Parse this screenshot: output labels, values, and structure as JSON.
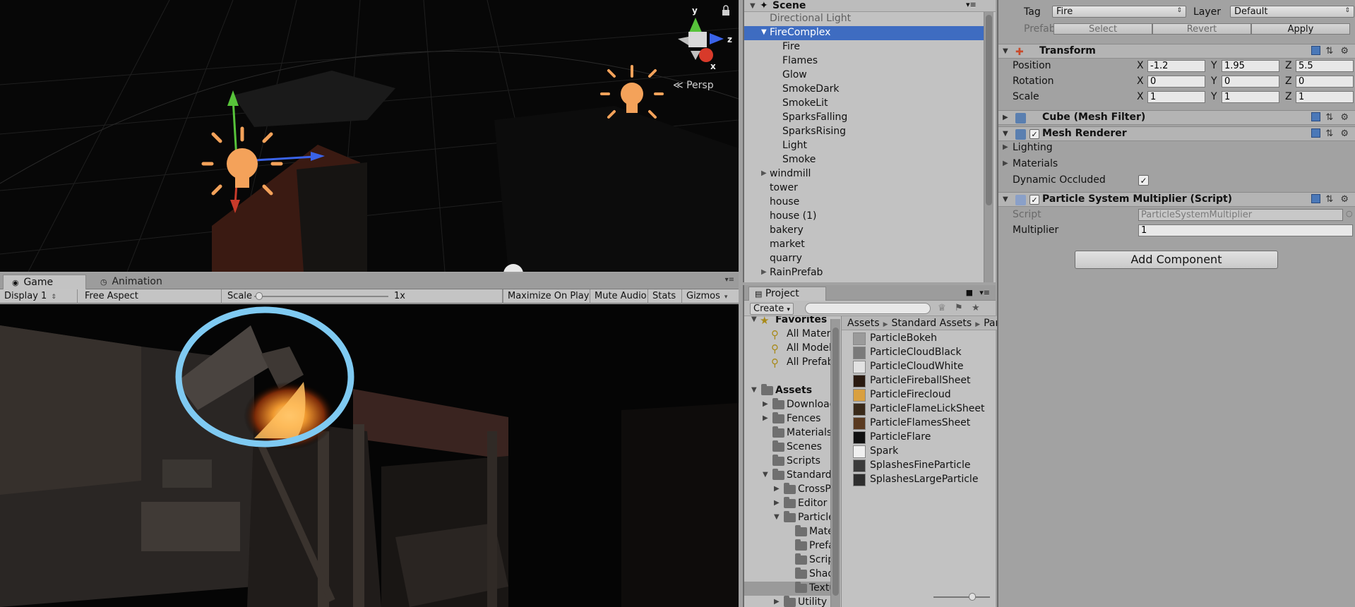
{
  "scene": {
    "tab_title": "Scene",
    "persp_label": "Persp",
    "gizmo_axes": {
      "y": "y",
      "z": "z",
      "x": "x"
    }
  },
  "game": {
    "tabs": [
      {
        "label": "Game",
        "icon": "game-controller-icon"
      },
      {
        "label": "Animation",
        "icon": "clock-icon"
      }
    ],
    "toolbar": {
      "display": "Display 1",
      "aspect": "Free Aspect",
      "scale_label": "Scale",
      "scale_value": "1x",
      "maximize": "Maximize On Play",
      "mute": "Mute Audio",
      "stats": "Stats",
      "gizmos": "Gizmos"
    }
  },
  "hierarchy": {
    "title": "Scene",
    "items": [
      {
        "label": "Directional Light",
        "indent": 0,
        "fold": "",
        "dim": true,
        "selected": false
      },
      {
        "label": "FireComplex",
        "indent": 0,
        "fold": "▼",
        "dim": false,
        "selected": true
      },
      {
        "label": "Fire",
        "indent": 1,
        "fold": "",
        "dim": false,
        "selected": false
      },
      {
        "label": "Flames",
        "indent": 1,
        "fold": "",
        "dim": false,
        "selected": false
      },
      {
        "label": "Glow",
        "indent": 1,
        "fold": "",
        "dim": false,
        "selected": false
      },
      {
        "label": "SmokeDark",
        "indent": 1,
        "fold": "",
        "dim": false,
        "selected": false
      },
      {
        "label": "SmokeLit",
        "indent": 1,
        "fold": "",
        "dim": false,
        "selected": false
      },
      {
        "label": "SparksFalling",
        "indent": 1,
        "fold": "",
        "dim": false,
        "selected": false
      },
      {
        "label": "SparksRising",
        "indent": 1,
        "fold": "",
        "dim": false,
        "selected": false
      },
      {
        "label": "Light",
        "indent": 1,
        "fold": "",
        "dim": false,
        "selected": false
      },
      {
        "label": "Smoke",
        "indent": 1,
        "fold": "",
        "dim": false,
        "selected": false
      },
      {
        "label": "windmill",
        "indent": 0,
        "fold": "▶",
        "dim": false,
        "selected": false
      },
      {
        "label": "tower",
        "indent": 0,
        "fold": "",
        "dim": false,
        "selected": false
      },
      {
        "label": "house",
        "indent": 0,
        "fold": "",
        "dim": false,
        "selected": false
      },
      {
        "label": "house (1)",
        "indent": 0,
        "fold": "",
        "dim": false,
        "selected": false
      },
      {
        "label": "bakery",
        "indent": 0,
        "fold": "",
        "dim": false,
        "selected": false
      },
      {
        "label": "market",
        "indent": 0,
        "fold": "",
        "dim": false,
        "selected": false
      },
      {
        "label": "quarry",
        "indent": 0,
        "fold": "",
        "dim": false,
        "selected": false
      },
      {
        "label": "RainPrefab",
        "indent": 0,
        "fold": "▶",
        "dim": false,
        "selected": false
      }
    ]
  },
  "project": {
    "tab_title": "Project",
    "create_label": "Create",
    "search_placeholder": "",
    "tree": [
      {
        "label": "Favorites",
        "depth": 0,
        "fold": "▼",
        "kind": "star",
        "bold": true,
        "selected": false
      },
      {
        "label": "All Materials",
        "depth": 1,
        "fold": "",
        "kind": "search",
        "bold": false,
        "selected": false
      },
      {
        "label": "All Models",
        "depth": 1,
        "fold": "",
        "kind": "search",
        "bold": false,
        "selected": false
      },
      {
        "label": "All Prefabs",
        "depth": 1,
        "fold": "",
        "kind": "search",
        "bold": false,
        "selected": false
      },
      {
        "label": "",
        "depth": 0,
        "fold": "",
        "kind": "none",
        "bold": false,
        "selected": false
      },
      {
        "label": "Assets",
        "depth": 0,
        "fold": "▼",
        "kind": "folder",
        "bold": true,
        "selected": false
      },
      {
        "label": "Downloads",
        "depth": 1,
        "fold": "▶",
        "kind": "folder",
        "bold": false,
        "selected": false
      },
      {
        "label": "Fences",
        "depth": 1,
        "fold": "▶",
        "kind": "folder",
        "bold": false,
        "selected": false
      },
      {
        "label": "Materials",
        "depth": 1,
        "fold": "",
        "kind": "folder",
        "bold": false,
        "selected": false
      },
      {
        "label": "Scenes",
        "depth": 1,
        "fold": "",
        "kind": "folder",
        "bold": false,
        "selected": false
      },
      {
        "label": "Scripts",
        "depth": 1,
        "fold": "",
        "kind": "folder",
        "bold": false,
        "selected": false
      },
      {
        "label": "Standard Assets",
        "depth": 1,
        "fold": "▼",
        "kind": "folder",
        "bold": false,
        "selected": false
      },
      {
        "label": "CrossPlatformInput",
        "depth": 2,
        "fold": "▶",
        "kind": "folder",
        "bold": false,
        "selected": false
      },
      {
        "label": "Editor",
        "depth": 2,
        "fold": "▶",
        "kind": "folder",
        "bold": false,
        "selected": false
      },
      {
        "label": "ParticleSystems",
        "depth": 2,
        "fold": "▼",
        "kind": "folder",
        "bold": false,
        "selected": false
      },
      {
        "label": "Materials",
        "depth": 3,
        "fold": "",
        "kind": "folder",
        "bold": false,
        "selected": false
      },
      {
        "label": "Prefabs",
        "depth": 3,
        "fold": "",
        "kind": "folder",
        "bold": false,
        "selected": false
      },
      {
        "label": "Scripts",
        "depth": 3,
        "fold": "",
        "kind": "folder",
        "bold": false,
        "selected": false
      },
      {
        "label": "Shaders",
        "depth": 3,
        "fold": "",
        "kind": "folder",
        "bold": false,
        "selected": false
      },
      {
        "label": "Textures",
        "depth": 3,
        "fold": "",
        "kind": "folder",
        "bold": false,
        "selected": true
      },
      {
        "label": "Utility",
        "depth": 2,
        "fold": "▶",
        "kind": "folder",
        "bold": false,
        "selected": false
      }
    ],
    "breadcrumb": [
      "Assets",
      "Standard Assets",
      "ParticleSystems"
    ],
    "assets": [
      {
        "label": "ParticleBokeh",
        "thumb": "#9a9a9a"
      },
      {
        "label": "ParticleCloudBlack",
        "thumb": "#7a7a7a"
      },
      {
        "label": "ParticleCloudWhite",
        "thumb": "#e2e2e2"
      },
      {
        "label": "ParticleFireballSheet",
        "thumb": "#2a1a10"
      },
      {
        "label": "ParticleFirecloud",
        "thumb": "#d9a040"
      },
      {
        "label": "ParticleFlameLickSheet",
        "thumb": "#3a2a1a"
      },
      {
        "label": "ParticleFlamesSheet",
        "thumb": "#5a3a20"
      },
      {
        "label": "ParticleFlare",
        "thumb": "#111111"
      },
      {
        "label": "Spark",
        "thumb": "#f0f0f0"
      },
      {
        "label": "SplashesFineParticle",
        "thumb": "#3a3a3a"
      },
      {
        "label": "SplashesLargeParticle",
        "thumb": "#2e2e2e"
      }
    ]
  },
  "inspector": {
    "tag_label": "Tag",
    "tag_value": "Fire",
    "layer_label": "Layer",
    "layer_value": "Default",
    "prefab_label": "Prefab",
    "prefab_select": "Select",
    "prefab_revert": "Revert",
    "prefab_apply": "Apply",
    "transform": {
      "title": "Transform",
      "rows": [
        {
          "label": "Position",
          "x": "-1.2",
          "y": "1.95",
          "z": "5.5"
        },
        {
          "label": "Rotation",
          "x": "0",
          "y": "0",
          "z": "0"
        },
        {
          "label": "Scale",
          "x": "1",
          "y": "1",
          "z": "1"
        }
      ]
    },
    "axis_labels": {
      "x": "X",
      "y": "Y",
      "z": "Z"
    },
    "mesh_filter_title": "Cube (Mesh Filter)",
    "mesh_renderer": {
      "title": "Mesh Renderer",
      "lighting": "Lighting",
      "materials": "Materials",
      "dynamic_occluded": "Dynamic Occluded"
    },
    "script_component": {
      "title": "Particle System Multiplier (Script)",
      "script_label": "Script",
      "script_value": "ParticleSystemMultiplier",
      "multiplier_label": "Multiplier",
      "multiplier_value": "1"
    },
    "add_component": "Add Component"
  },
  "colors": {
    "selection": "#3e6cc1",
    "annotation_circle": "#7fcaf2",
    "light_icon": "#f4a25a"
  }
}
